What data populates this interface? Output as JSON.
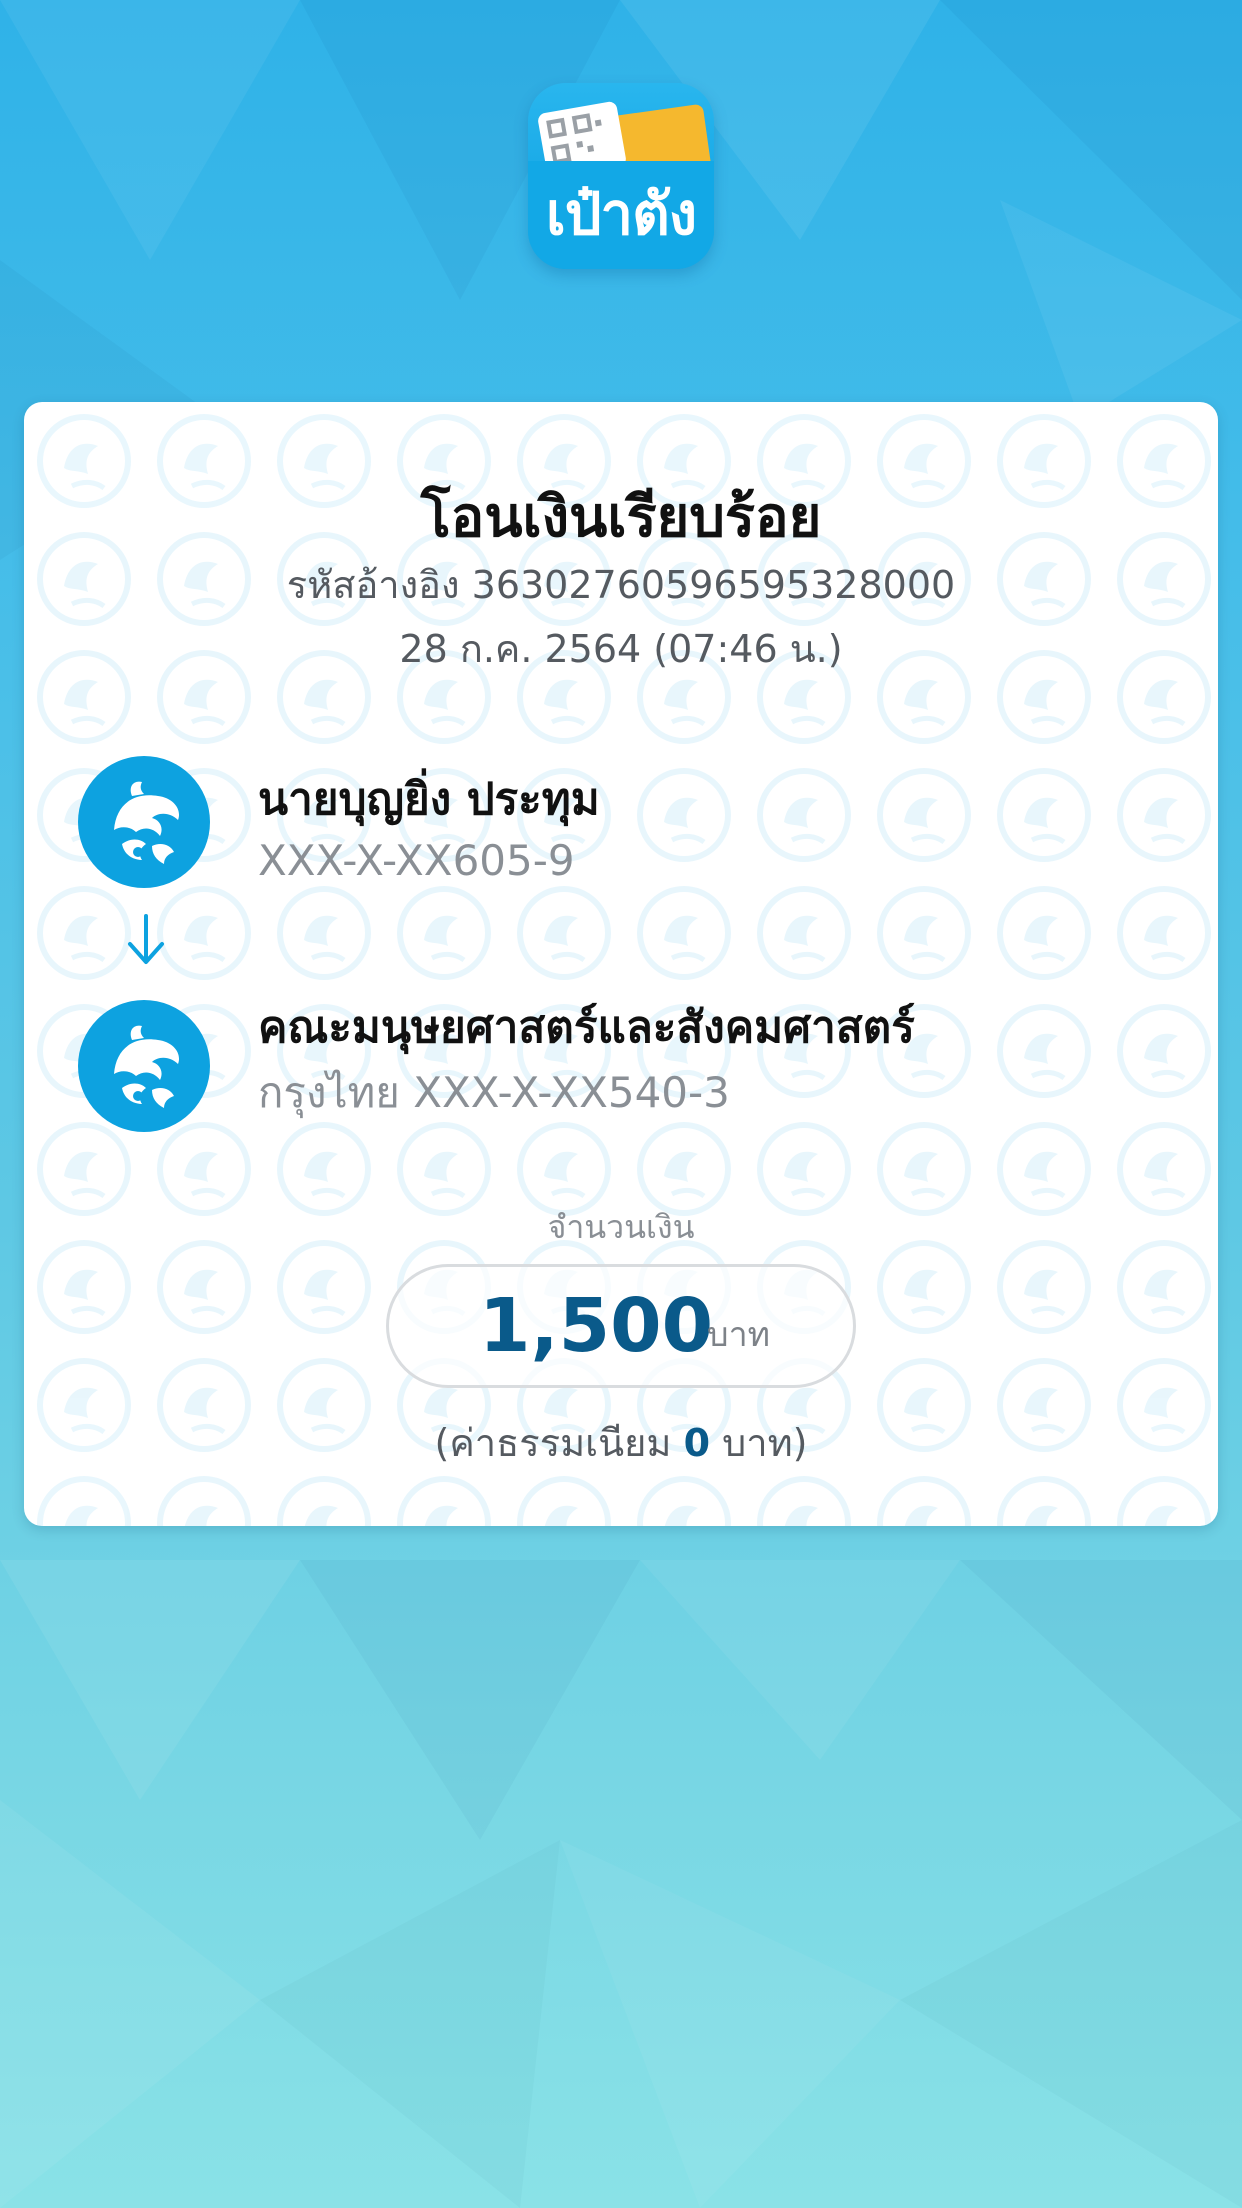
{
  "app": {
    "icon_label": "เป๋าตัง"
  },
  "receipt": {
    "title": "โอนเงินเรียบร้อย",
    "reference_label": "รหัสอ้างอิง",
    "reference_number": "36302760596595328000",
    "date_time": "28 ก.ค. 2564 (07:46 น.)"
  },
  "sender": {
    "name": "นายบุญยิ่ง ประทุม",
    "account": "XXX-X-XX605-9",
    "bank_icon": "krungthai-bank-logo"
  },
  "receiver": {
    "name": "คณะมนุษยศาสตร์และสังคมศาสตร์",
    "account": "กรุงไทย XXX-X-XX540-3",
    "bank_icon": "krungthai-bank-logo"
  },
  "amount": {
    "label": "จำนวนเงิน",
    "value": "1,500",
    "unit": "บาท"
  },
  "fee": {
    "prefix": "(ค่าธรรมเนียม",
    "value": "0",
    "suffix": "บาท)"
  },
  "colors": {
    "primary_blue": "#0da2e0",
    "amount_blue": "#0a5a8a",
    "background_top": "#2fb2e8",
    "background_bottom": "#8ae2e7"
  }
}
